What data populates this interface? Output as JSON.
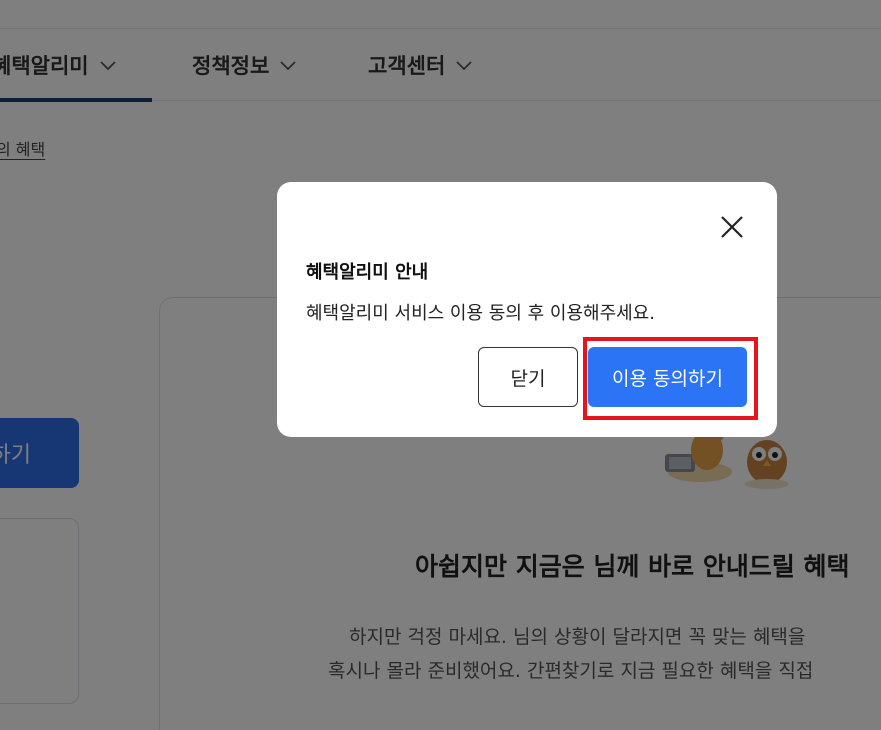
{
  "nav": {
    "items": [
      {
        "label": "혜택알리미",
        "active": true
      },
      {
        "label": "정책정보",
        "active": false
      },
      {
        "label": "고객센터",
        "active": false
      }
    ]
  },
  "breadcrumb": "의 혜택",
  "left_button_label": "하기",
  "main": {
    "headline": "아쉽지만 지금은 님께 바로 안내드릴 혜택",
    "desc_line1": "하지만 걱정 마세요. 님의 상황이 달라지면 꼭 맞는 혜택을",
    "desc_line2": "혹시나 몰라 준비했어요. 간편찾기로 지금 필요한 혜택을 직접"
  },
  "modal": {
    "title": "혜택알리미 안내",
    "message": "혜택알리미 서비스 이용 동의 후 이용해주세요.",
    "close_label": "닫기",
    "agree_label": "이용 동의하기"
  },
  "colors": {
    "nav_active": "#1f3d6e",
    "primary": "#2b74f5",
    "highlight": "#e8131b",
    "overlay": "rgba(0,0,0,0.5)"
  }
}
